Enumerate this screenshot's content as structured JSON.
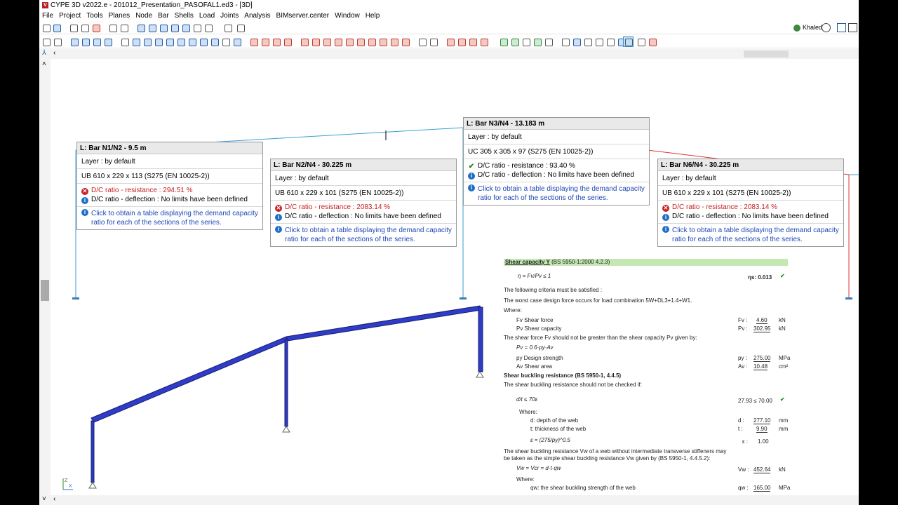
{
  "window": {
    "title": "CYPE 3D v2022.e - 201012_Presentation_PASOFAL1.ed3 - [3D]",
    "app_icon_letter": "V"
  },
  "menu": [
    "File",
    "Project",
    "Tools",
    "Planes",
    "Node",
    "Bar",
    "Shells",
    "Load",
    "Joints",
    "Analysis",
    "BIMserver.center",
    "Window",
    "Help"
  ],
  "user": {
    "name": "Khaled"
  },
  "tooltips": {
    "n1n2": {
      "header": "L: Bar N1/N2 - 9.5 m",
      "layer": "Layer : by default",
      "section": "UB 610 x 229 x 113 (S275 (EN 10025-2))",
      "resistance": "D/C ratio - resistance : 294.51 %",
      "deflection": "D/C ratio - deflection  : No limits have been defined",
      "note": "Click to obtain a table displaying the demand capacity ratio for each of the sections of the series."
    },
    "n2n4": {
      "header": "L: Bar N2/N4 - 30.225 m",
      "layer": "Layer : by default",
      "section": "UB 610 x 229 x 101 (S275 (EN 10025-2))",
      "resistance": "D/C ratio - resistance : 2083.14 %",
      "deflection": "D/C ratio - deflection  : No limits have been defined",
      "note": "Click to obtain a table displaying the demand capacity ratio for each of the sections of the series."
    },
    "n3n4": {
      "header": "L: Bar N3/N4 - 13.183 m",
      "layer": "Layer : by default",
      "section": "UC 305 x 305 x 97 (S275 (EN 10025-2))",
      "resistance": "D/C ratio - resistance : 93.40 %",
      "deflection": "D/C ratio - deflection  : No limits have been defined",
      "note": "Click to obtain a table displaying the demand capacity ratio for each of the sections of the series."
    },
    "n6n4": {
      "header": "L: Bar N6/N4 - 30.225 m",
      "layer": "Layer : by default",
      "section": "UB 610 x 229 x 101 (S275 (EN 10025-2))",
      "resistance": "D/C ratio - resistance : 2083.14 %",
      "deflection": "D/C ratio - deflection  : No limits have been defined",
      "note": "Click to obtain a table displaying the demand capacity ratio for each of the sections of the series."
    }
  },
  "report": {
    "title": "Shear capacity Y",
    "title_ref": "(BS 5950-1:2000 4.2.3)",
    "eta_label": "ηs: 0.013",
    "criteria": "The following criteria must be satisfied :",
    "worst_case": "The worst case design force occurs for load combination 5W+DL3+1.4+W1.",
    "where1": "Where:",
    "fv_label": "Fv Shear force",
    "fv_sym": "Fv :",
    "fv_val": "4.60",
    "fv_unit": "kN",
    "pv_label": "Pv Shear capacity",
    "pv_sym": "Pv :",
    "pv_val": "302.95",
    "pv_unit": "kN",
    "shear_force_text": "The shear force Fv should not be greater than the shear capacity Pv given by:",
    "py_label": "py Design strength",
    "py_sym": "py :",
    "py_val": "275.00",
    "py_unit": "MPa",
    "av_label": "Av Shear area",
    "av_sym": "Av :",
    "av_val": "10.48",
    "av_unit": "cm²",
    "buckling_title": "Shear buckling resistance",
    "buckling_ref": "(BS 5950-1, 4.4.5)",
    "buckling_text": "The shear buckling resistance should not be checked if:",
    "buckling_check": "27.93 ≤ 70.00",
    "where2": "Where:",
    "d_label": "d: depth of the web",
    "d_sym": "d :",
    "d_val": "277.10",
    "d_unit": "mm",
    "t_label": "t: thickness of the web",
    "t_sym": "t :",
    "t_val": "9.90",
    "t_unit": "mm",
    "eps_val": "1.00",
    "vw_text1": "The shear buckling resistance Vw of a web without intermediate transverse stiffeners may",
    "vw_text2": "be taken as the simple shear buckling resistance Vw given by (BS 5950-1, 4.4.5.2):",
    "vw_sym": "Vw :",
    "vw_val": "452.64",
    "vw_unit": "kN",
    "where3": "Where:",
    "qw_label": "qw: the shear buckling strength of the web",
    "qw_sym": "qw :",
    "qw_val": "165.00",
    "qw_unit": "MPa"
  },
  "axis": {
    "z": "Z",
    "x": "X"
  }
}
